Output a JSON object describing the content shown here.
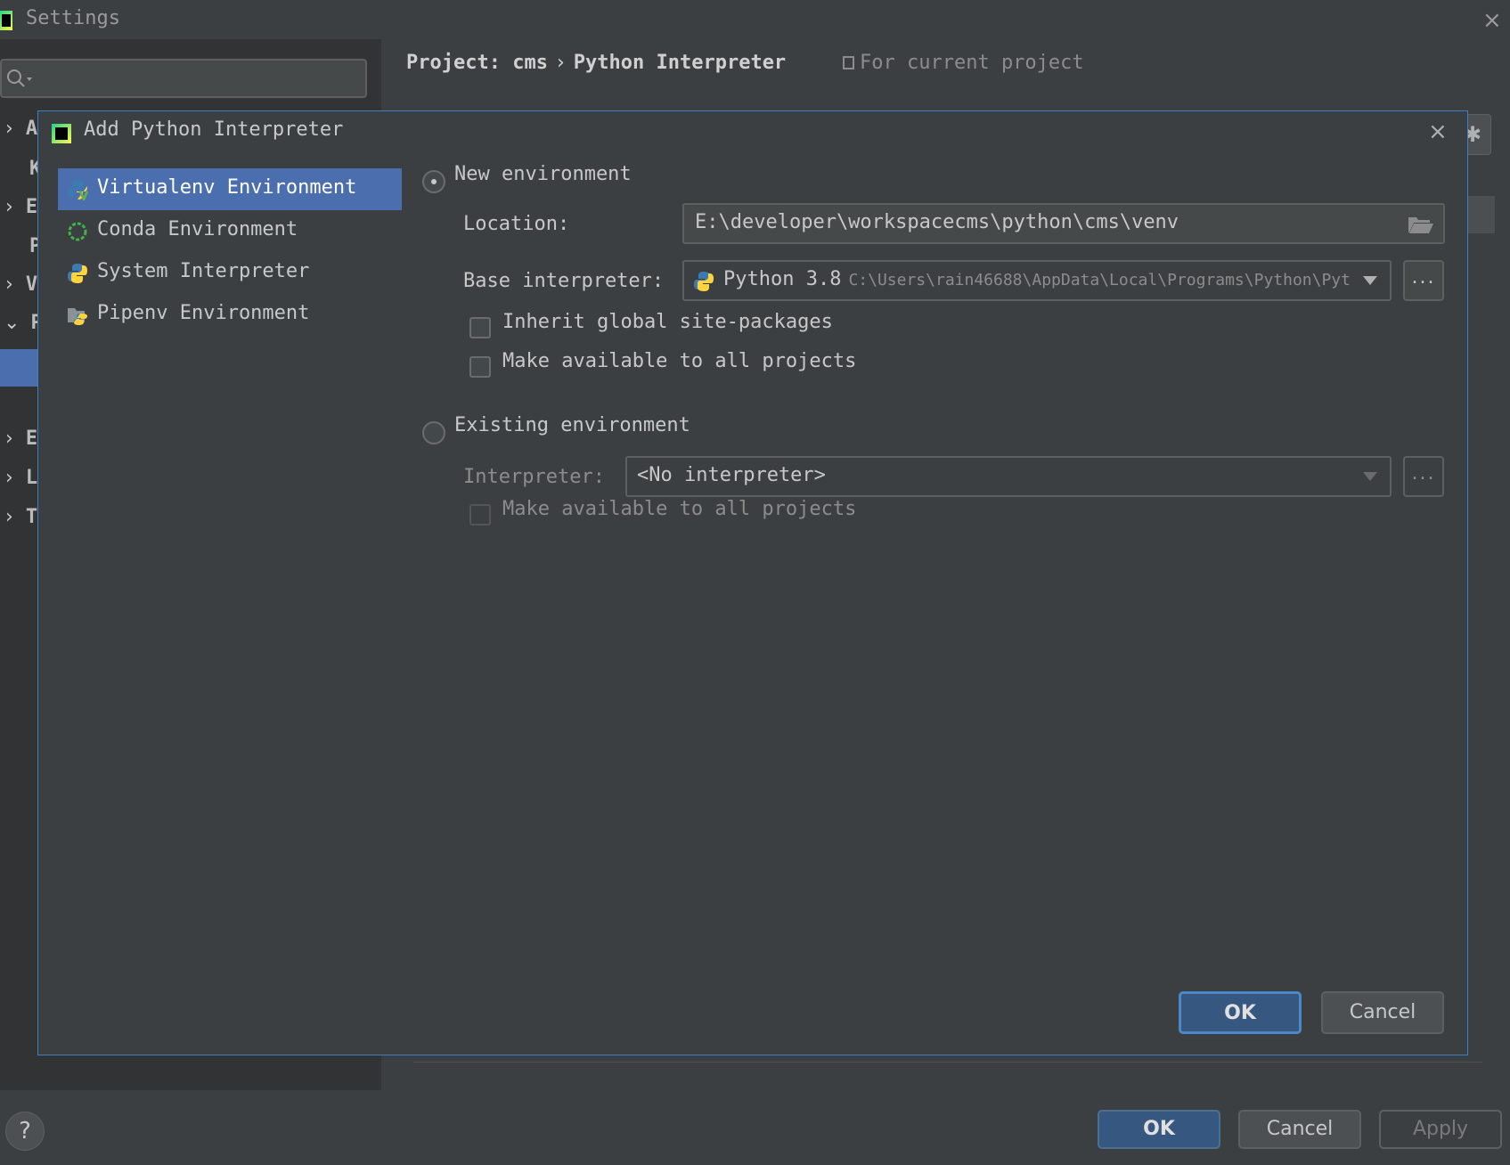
{
  "window": {
    "title": "Settings",
    "close_label": "×"
  },
  "search": {
    "value": ""
  },
  "tree": {
    "items": [
      {
        "chevron": "›",
        "letter": "A"
      },
      {
        "chevron": "",
        "letter": "K"
      },
      {
        "chevron": "›",
        "letter": "E"
      },
      {
        "chevron": "",
        "letter": "P"
      },
      {
        "chevron": "›",
        "letter": "V"
      },
      {
        "chevron": "⌄",
        "letter": "P"
      },
      {
        "chevron": "›",
        "letter": "E"
      },
      {
        "chevron": "›",
        "letter": "L"
      },
      {
        "chevron": "›",
        "letter": "T"
      }
    ]
  },
  "header": {
    "project": "Project: cms",
    "separator": "›",
    "page": "Python Interpreter",
    "scope": "For current project"
  },
  "dialog": {
    "title": "Add Python Interpreter",
    "close_label": "×",
    "env_types": [
      {
        "label": "Virtualenv Environment",
        "icon": "virtualenv-icon"
      },
      {
        "label": "Conda Environment",
        "icon": "conda-icon"
      },
      {
        "label": "System Interpreter",
        "icon": "python-icon"
      },
      {
        "label": "Pipenv Environment",
        "icon": "pipenv-icon"
      }
    ],
    "new_env": {
      "label": "New environment",
      "location_label": "Location:",
      "location_value": "E:\\developer\\workspacecms\\python\\cms\\venv",
      "base_label": "Base interpreter:",
      "base_value": "Python 3.8",
      "base_path": "C:\\Users\\rain46688\\AppData\\Local\\Programs\\Python\\Pyt",
      "inherit_label": "Inherit global site-packages",
      "make_available_label": "Make available to all projects"
    },
    "existing_env": {
      "label": "Existing environment",
      "interpreter_label": "Interpreter:",
      "interpreter_value": "<No interpreter>",
      "make_available_label": "Make available to all projects"
    },
    "ellipsis": "...",
    "ok_label": "OK",
    "cancel_label": "Cancel"
  },
  "footer": {
    "help_label": "?",
    "ok_label": "OK",
    "cancel_label": "Cancel",
    "apply_label": "Apply"
  },
  "colors": {
    "background": "#3c3f41",
    "selection": "#4b6eaf",
    "primary_button": "#365880",
    "dialog_border": "#3f7fbf"
  }
}
